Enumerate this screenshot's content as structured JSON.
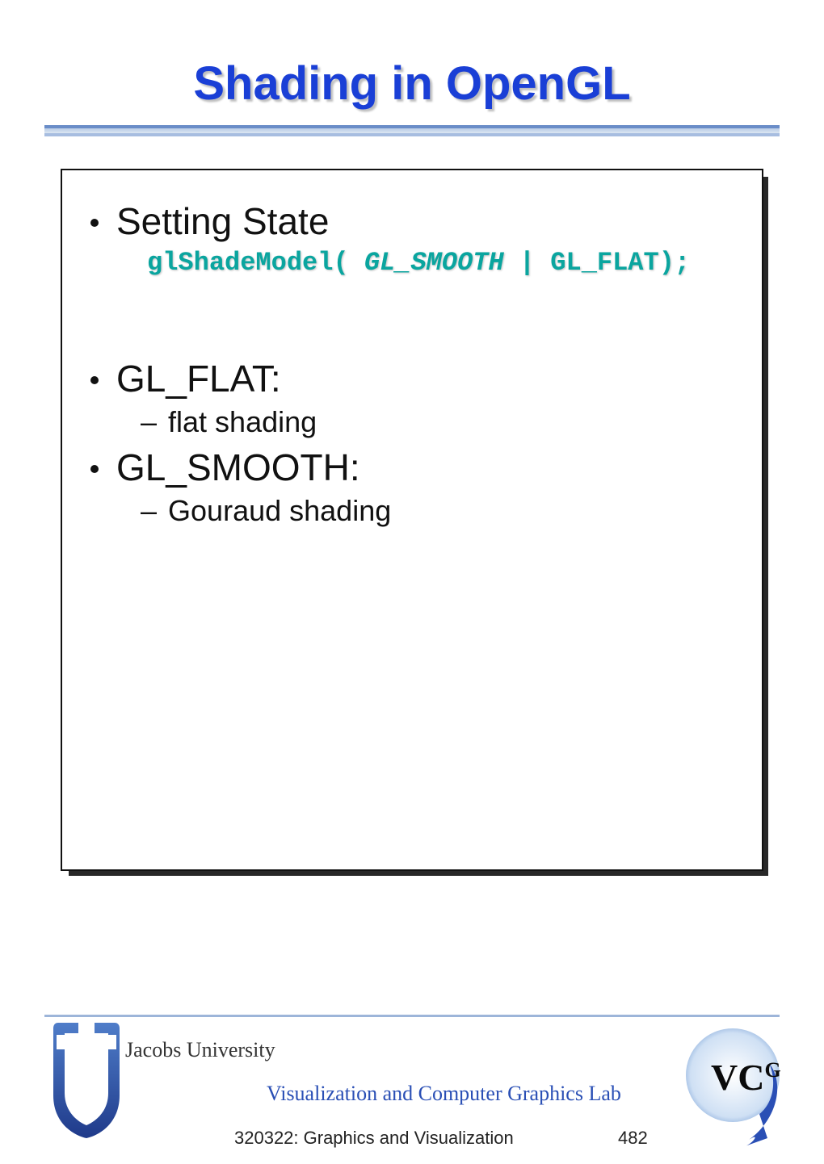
{
  "title": "Shading in OpenGL",
  "content": {
    "bullet1": "Setting State",
    "code": {
      "prefix": "glShadeModel( ",
      "emph": "GL_SMOOTH",
      "suffix": " | GL_FLAT);"
    },
    "bullet2": "GL_FLAT:",
    "sub2": "flat shading",
    "bullet3": "GL_SMOOTH:",
    "sub3": "Gouraud shading"
  },
  "footer": {
    "university": "Jacobs University",
    "lab": "Visualization and Computer Graphics Lab",
    "course": "320322: Graphics and Visualization",
    "page": "482",
    "vcg_label": "VC",
    "vcg_sup": "G"
  }
}
